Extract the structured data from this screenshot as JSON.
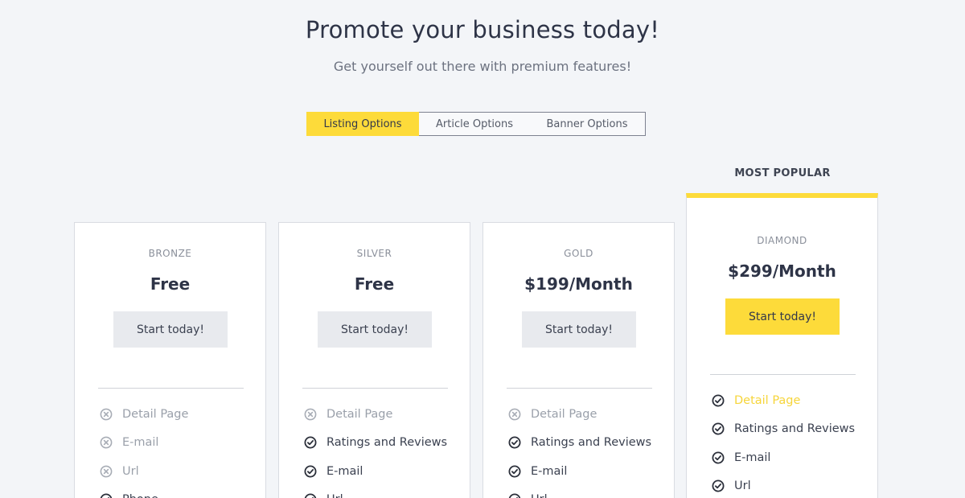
{
  "header": {
    "title": "Promote your business today!",
    "subtitle": "Get yourself out there with premium features!"
  },
  "tabs": [
    {
      "label": "Listing Options",
      "active": true
    },
    {
      "label": "Article Options",
      "active": false
    },
    {
      "label": "Banner Options",
      "active": false
    }
  ],
  "popular_label": "MOST POPULAR",
  "accent_color": "#fddb3a",
  "plans": [
    {
      "tier": "BRONZE",
      "price": "Free",
      "cta": "Start today!",
      "features": [
        {
          "label": "Detail Page",
          "included": false
        },
        {
          "label": "E-mail",
          "included": false
        },
        {
          "label": "Url",
          "included": false
        },
        {
          "label": "Phone",
          "included": true
        }
      ]
    },
    {
      "tier": "SILVER",
      "price": "Free",
      "cta": "Start today!",
      "features": [
        {
          "label": "Detail Page",
          "included": false
        },
        {
          "label": "Ratings and Reviews",
          "included": true
        },
        {
          "label": "E-mail",
          "included": true
        },
        {
          "label": "Url",
          "included": true
        }
      ]
    },
    {
      "tier": "GOLD",
      "price": "$199/Month",
      "cta": "Start today!",
      "features": [
        {
          "label": "Detail Page",
          "included": false
        },
        {
          "label": "Ratings and Reviews",
          "included": true
        },
        {
          "label": "E-mail",
          "included": true
        },
        {
          "label": "Url",
          "included": true
        }
      ]
    },
    {
      "tier": "DIAMOND",
      "price": "$299/Month",
      "cta": "Start today!",
      "features": [
        {
          "label": "Detail Page",
          "included": true,
          "highlighted": true
        },
        {
          "label": "Ratings and Reviews",
          "included": true
        },
        {
          "label": "E-mail",
          "included": true
        },
        {
          "label": "Url",
          "included": true
        }
      ]
    }
  ],
  "icons": {
    "included": "check-circle-icon",
    "excluded": "x-circle-icon"
  }
}
